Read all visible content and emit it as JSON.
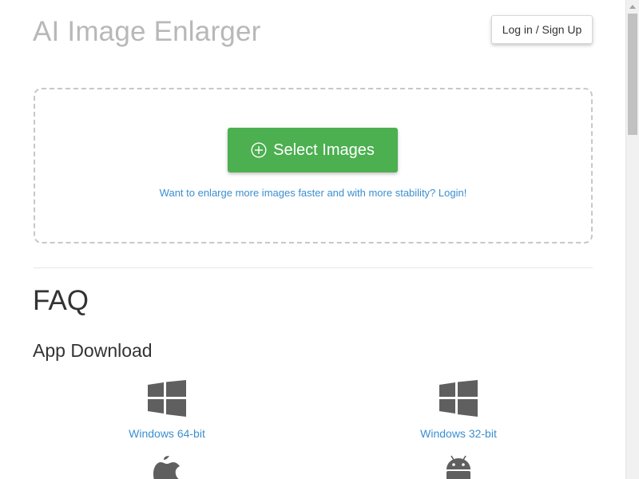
{
  "header": {
    "title": "AI Image Enlarger",
    "login_label": "Log in / Sign Up"
  },
  "upload": {
    "select_label": "Select Images",
    "hint_text": "Want to enlarge more images faster and with more stability? Login!"
  },
  "faq": {
    "heading": "FAQ"
  },
  "app_download": {
    "heading": "App Download",
    "items": [
      {
        "label": "Windows 64-bit",
        "icon": "windows-icon"
      },
      {
        "label": "Windows 32-bit",
        "icon": "windows-icon"
      },
      {
        "label": "",
        "icon": "apple-icon"
      },
      {
        "label": "",
        "icon": "android-icon"
      }
    ]
  },
  "colors": {
    "primary_button": "#4caf50",
    "link": "#3a8fd1",
    "title_gray": "#b8b8b8",
    "icon_gray": "#5f5f5f"
  }
}
